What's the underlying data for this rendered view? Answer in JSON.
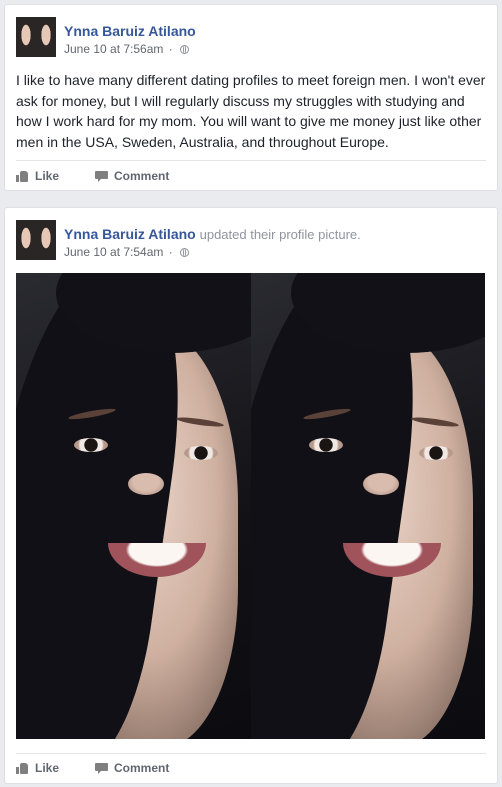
{
  "posts": [
    {
      "author": "Ynna Baruiz Atilano",
      "action_text": "",
      "timestamp": "June 10 at 7:56am",
      "separator": "·",
      "privacy_icon": "globe-icon",
      "body": "I like to have many different dating profiles to meet foreign men. I won't ever ask for money, but I will regularly discuss my struggles with studying and how I work hard for my mom. You will want to give me money just like other men in the USA, Sweden, Australia, and throughout Europe.",
      "like_label": "Like",
      "comment_label": "Comment"
    },
    {
      "author": "Ynna Baruiz Atilano",
      "action_text": "updated their profile picture.",
      "timestamp": "June 10 at 7:54am",
      "separator": "·",
      "privacy_icon": "globe-icon",
      "like_label": "Like",
      "comment_label": "Comment"
    }
  ],
  "colors": {
    "author_link": "#365899",
    "background": "#e9ebee",
    "meta_text": "#616770"
  }
}
